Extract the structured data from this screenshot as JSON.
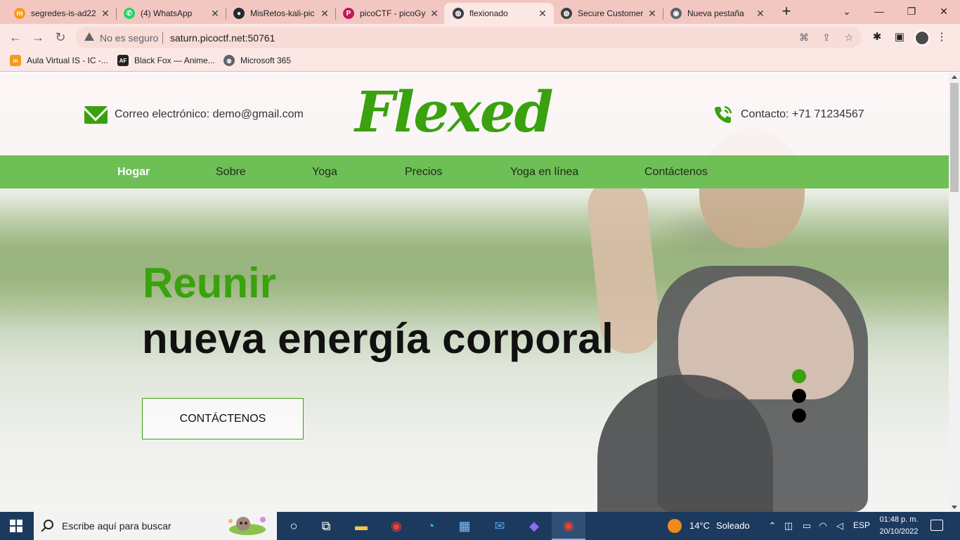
{
  "browser": {
    "tabs": [
      {
        "title": "segredes-is-ad22",
        "icon": "moodle-icon",
        "color": "#f79a1a"
      },
      {
        "title": "(4) WhatsApp",
        "icon": "whatsapp-icon",
        "color": "#25d366"
      },
      {
        "title": "MisRetos-kali-pic",
        "icon": "github-icon",
        "color": "#24292e"
      },
      {
        "title": "picoCTF - picoGy",
        "icon": "picoctf-icon",
        "color": "#c2185b"
      },
      {
        "title": "flexionado",
        "icon": "globe-icon",
        "color": "#3c4043"
      },
      {
        "title": "Secure Customer",
        "icon": "globe-icon",
        "color": "#3c4043"
      },
      {
        "title": "Nueva pestaña",
        "icon": "chrome-icon",
        "color": "#5f6368"
      }
    ],
    "active_tab_index": 4,
    "address": {
      "security_label": "No es seguro",
      "url": "saturn.picoctf.net:50761"
    },
    "bookmarks": [
      {
        "label": "Aula Virtual IS - IC -...",
        "icon": "moodle-icon",
        "color": "#f79a1a"
      },
      {
        "label": "Black Fox — Anime...",
        "icon": "af-icon",
        "color": "#222222"
      },
      {
        "label": "Microsoft 365",
        "icon": "globe-icon",
        "color": "#5f6368"
      }
    ]
  },
  "site": {
    "email": "Correo electrónico: demo@gmail.com",
    "logo": "Flexed",
    "contact": "Contacto: +71 71234567",
    "nav": [
      "Hogar",
      "Sobre",
      "Yoga",
      "Precios",
      "Yoga en línea",
      "Contáctenos"
    ],
    "active_nav": 0,
    "headline_accent": "Reunir",
    "headline_main": "nueva energía corporal",
    "cta_label": "CONTÁCTENOS",
    "slider": {
      "count": 3,
      "active": 0
    },
    "accent_color": "#3aa10f",
    "nav_color": "#6fbf57"
  },
  "taskbar": {
    "search_placeholder": "Escribe aquí para buscar",
    "apps": [
      "cortana-icon",
      "task-view-icon",
      "file-explorer-icon",
      "chrome-icon",
      "edge-icon",
      "store-icon",
      "mail-icon",
      "obsidian-icon",
      "chrome-profile-icon"
    ],
    "weather_temp": "14°C",
    "weather_text": "Soleado",
    "language": "ESP",
    "time": "01:48 p. m.",
    "date": "20/10/2022"
  }
}
